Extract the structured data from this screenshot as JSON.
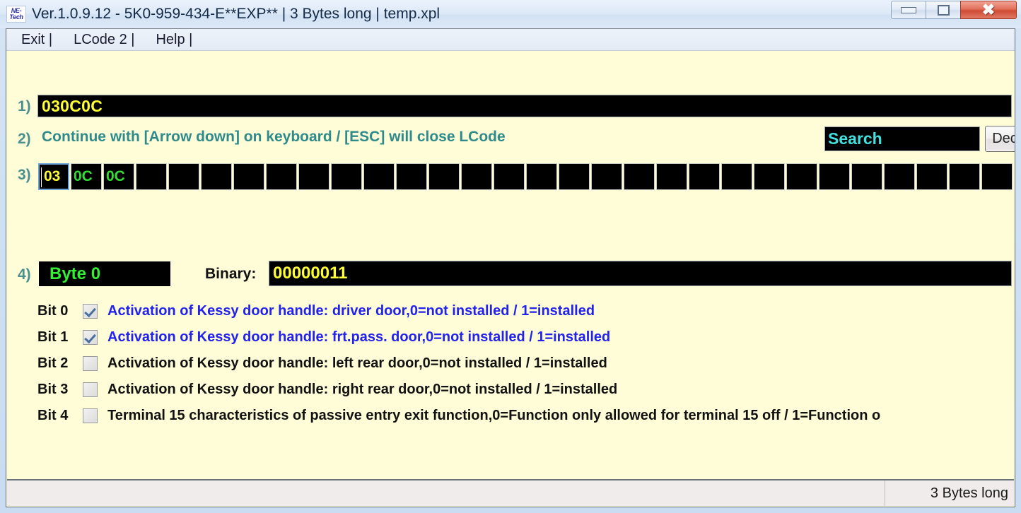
{
  "window": {
    "title": "Ver.1.0.9.12 -   5K0-959-434-E**EXP** | 3 Bytes long | temp.xpl",
    "icon_line1": "NE-",
    "icon_line2": "Tech",
    "controls": {
      "minimize": "minimize-icon",
      "maximize": "maximize-icon",
      "close": "✖"
    }
  },
  "menubar": {
    "items": [
      {
        "label": "Exit |"
      },
      {
        "label": "LCode 2 |"
      },
      {
        "label": "Help |"
      }
    ]
  },
  "steps": {
    "one": "1)",
    "two": "2)",
    "three": "3)",
    "four": "4)"
  },
  "code_field": {
    "value": "030C0C"
  },
  "hint": {
    "text": "Continue with [Arrow down] on keyboard / [ESC] will close LCode"
  },
  "search": {
    "value": "Search",
    "placeholder": "Search"
  },
  "dec_button": {
    "label": "Dec"
  },
  "bytes": {
    "cells": [
      {
        "value": "03",
        "selected": true
      },
      {
        "value": "0C",
        "selected": false
      },
      {
        "value": "0C",
        "selected": false
      },
      {
        "value": "",
        "selected": false
      },
      {
        "value": "",
        "selected": false
      },
      {
        "value": "",
        "selected": false
      },
      {
        "value": "",
        "selected": false
      },
      {
        "value": "",
        "selected": false
      },
      {
        "value": "",
        "selected": false
      },
      {
        "value": "",
        "selected": false
      },
      {
        "value": "",
        "selected": false
      },
      {
        "value": "",
        "selected": false
      },
      {
        "value": "",
        "selected": false
      },
      {
        "value": "",
        "selected": false
      },
      {
        "value": "",
        "selected": false
      },
      {
        "value": "",
        "selected": false
      },
      {
        "value": "",
        "selected": false
      },
      {
        "value": "",
        "selected": false
      },
      {
        "value": "",
        "selected": false
      },
      {
        "value": "",
        "selected": false
      },
      {
        "value": "",
        "selected": false
      },
      {
        "value": "",
        "selected": false
      },
      {
        "value": "",
        "selected": false
      },
      {
        "value": "",
        "selected": false
      },
      {
        "value": "",
        "selected": false
      },
      {
        "value": "",
        "selected": false
      },
      {
        "value": "",
        "selected": false
      },
      {
        "value": "",
        "selected": false
      },
      {
        "value": "",
        "selected": false
      },
      {
        "value": "",
        "selected": false
      }
    ]
  },
  "byte_detail": {
    "byte_label": "Byte 0",
    "binary_label": "Binary:",
    "binary_value": "00000011",
    "bits": [
      {
        "label": "Bit 0",
        "checked": true,
        "text": "Activation of Kessy door handle: driver door,0=not installed / 1=installed"
      },
      {
        "label": "Bit 1",
        "checked": true,
        "text": "Activation of Kessy door handle: frt.pass. door,0=not installed / 1=installed"
      },
      {
        "label": "Bit 2",
        "checked": false,
        "text": "Activation of Kessy door handle: left rear door,0=not installed / 1=installed"
      },
      {
        "label": "Bit 3",
        "checked": false,
        "text": "Activation of Kessy door handle: right rear door,0=not installed / 1=installed"
      },
      {
        "label": "Bit 4",
        "checked": false,
        "text": "Terminal 15 characteristics of passive entry exit function,0=Function only allowed for terminal 15 off / 1=Function o"
      }
    ]
  },
  "statusbar": {
    "right_text": "3 Bytes long"
  },
  "colors": {
    "content_bg": "#FFFDD8",
    "field_bg": "#000000",
    "code_yellow": "#FFFF33",
    "byte_green": "#33DD33",
    "search_cyan": "#40E0E0",
    "step_teal": "#4A8F8F",
    "hint_teal": "#2E8B8B",
    "active_bit_blue": "#2222EE",
    "close_red": "#CF4A33"
  }
}
